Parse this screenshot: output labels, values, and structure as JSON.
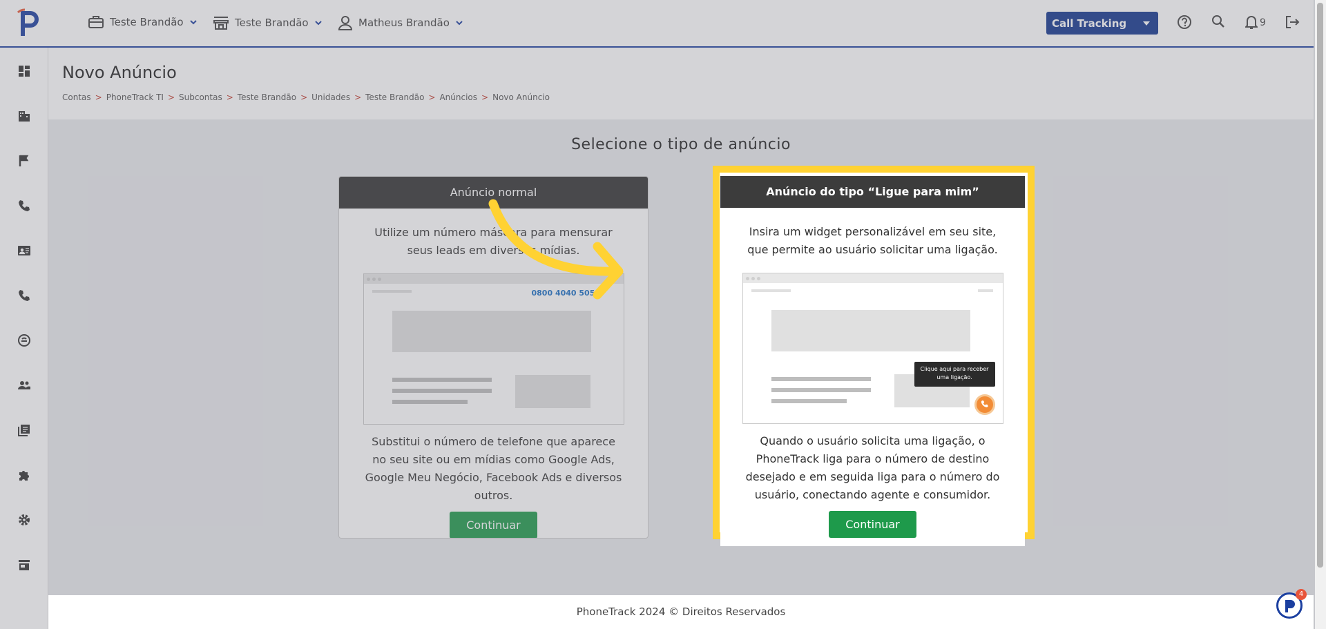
{
  "topbar": {
    "account1": "Teste Brandão",
    "account2": "Teste Brandão",
    "user": "Matheus Brandão",
    "product_select": "Call Tracking",
    "notifications_count": "9"
  },
  "page": {
    "title": "Novo Anúncio",
    "breadcrumb": [
      "Contas",
      "PhoneTrack TI",
      "Subcontas",
      "Teste Brandão",
      "Unidades",
      "Teste Brandão",
      "Anúncios",
      "Novo Anúncio"
    ],
    "breadcrumb_separator": ">"
  },
  "main": {
    "heading": "Selecione o tipo de anúncio",
    "card_normal": {
      "title": "Anúncio normal",
      "description": "Utilize um número máscara para mensurar seus leads em diversas mídias.",
      "mock_phone": "0800 4040 5050",
      "details": "Substitui o número de telefone que aparece no seu site ou em mídias como Google Ads, Google Meu Negócio, Facebook Ads e diversos outros.",
      "button": "Continuar"
    },
    "card_callme": {
      "title": "Anúncio do tipo “Ligue para mim”",
      "description": "Insira um widget personalizável em seu site, que permite ao usuário solicitar uma ligação.",
      "mock_tooltip": "Clique aqui para receber uma ligação.",
      "details": "Quando o usuário solicita uma ligação, o PhoneTrack liga para o número de destino desejado e em seguida liga para o número do usuário, conectando agente e consumidor.",
      "button": "Continuar"
    }
  },
  "footer": {
    "text": "PhoneTrack 2024 © Direitos Reservados"
  },
  "chat_widget": {
    "badge": "4"
  },
  "colors": {
    "brand_blue": "#12358e",
    "accent_green": "#1e9a4b",
    "highlight_yellow": "#ffd233",
    "call_orange": "#f28c36"
  }
}
